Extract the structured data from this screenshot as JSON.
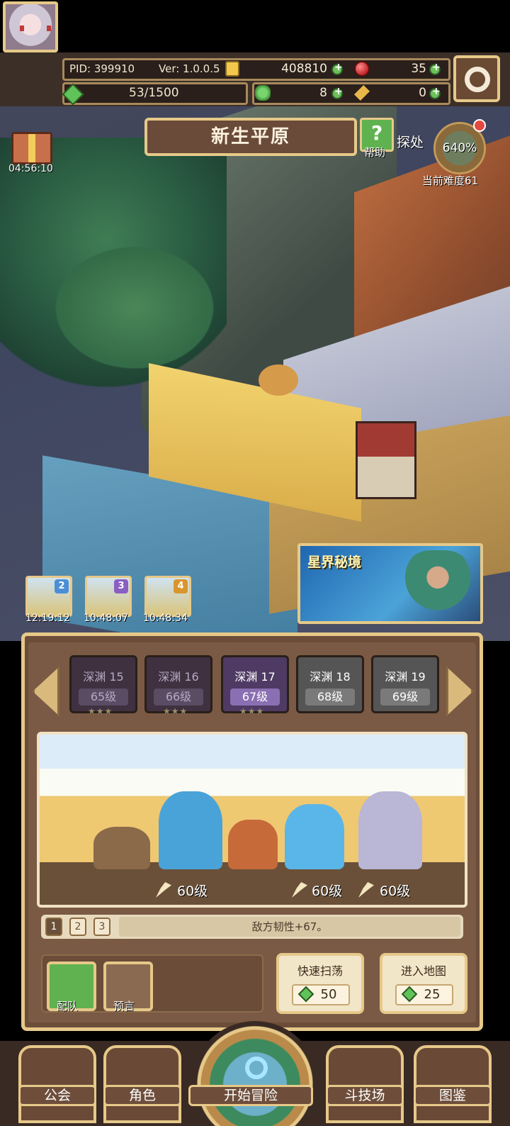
{
  "hud": {
    "pid": "PID: 399910",
    "version": "Ver: 1.0.0.5",
    "gold": "408810",
    "red_gem": "35",
    "stamina": "53/1500",
    "clover": "8",
    "keys": "0"
  },
  "gift": {
    "timer": "04:56:10"
  },
  "location": {
    "name": "新生平原",
    "help_label": "帮助",
    "explore_label": "探处"
  },
  "difficulty": {
    "percent": "640%",
    "label": "当前难度61"
  },
  "astral": {
    "title": "星界秘境"
  },
  "quest_slots": [
    {
      "num": "2",
      "time": "12:19:12",
      "badge_color": "#4a8fd6"
    },
    {
      "num": "3",
      "time": "10:48:07",
      "badge_color": "#8a5fc2"
    },
    {
      "num": "4",
      "time": "10:48:34",
      "badge_color": "#d9962e"
    }
  ],
  "levels": [
    {
      "name": "深渊 15",
      "level": "65级",
      "state": "cleared",
      "stars": "★★★"
    },
    {
      "name": "深渊 16",
      "level": "66级",
      "state": "cleared",
      "stars": "★★★"
    },
    {
      "name": "深渊 17",
      "level": "67级",
      "state": "active",
      "stars": "★★★"
    },
    {
      "name": "深渊 18",
      "level": "68级",
      "state": "locked",
      "stars": ""
    },
    {
      "name": "深渊 19",
      "level": "69级",
      "state": "locked",
      "stars": ""
    }
  ],
  "preview": {
    "enemy_levels": [
      "60级",
      "60级",
      "60级"
    ]
  },
  "waves": [
    "1",
    "2",
    "3"
  ],
  "effect_text": "敌方韧性+67。",
  "buttons": {
    "team": "配队",
    "prophecy": "预言",
    "quick_sweep": {
      "label": "快速扫荡",
      "cost": "50"
    },
    "enter_map": {
      "label": "进入地图",
      "cost": "25"
    }
  },
  "nav": {
    "guild": "公会",
    "character": "角色",
    "adventure": "开始冒险",
    "arena": "斗技场",
    "codex": "图鉴"
  }
}
